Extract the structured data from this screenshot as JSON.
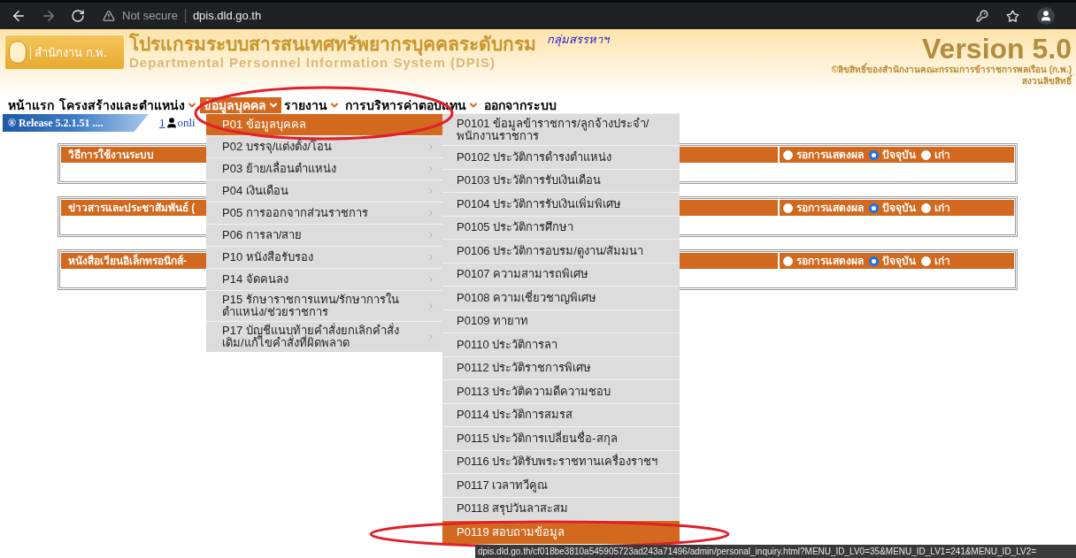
{
  "browser": {
    "security": "Not secure",
    "url": "dpis.dld.go.th"
  },
  "header": {
    "logo_text": "สำนักงาน ก.พ.",
    "title_th": "โปรแกรมระบบสารสนเทศทรัพยากรบุคคลระดับกรม",
    "title_en": "Departmental Personnel Information System (DPIS)",
    "group": "กลุ่มสรรหาฯ",
    "version": "Version 5.0",
    "copyright": "©ลิขสิทธิ์ของสำนักงานคณะกรรมการข้าราชการพลเรือน (ก.พ.)",
    "rights": "สงวนลิขสิทธิ์"
  },
  "menu_bar": [
    {
      "label": "หน้าแรก",
      "dropdown": false,
      "selected": false
    },
    {
      "label": "โครงสร้างและตำแหน่ง",
      "dropdown": true,
      "selected": false
    },
    {
      "label": "ข้อมูลบุคคล",
      "dropdown": true,
      "selected": true
    },
    {
      "label": "รายงาน",
      "dropdown": true,
      "selected": false
    },
    {
      "label": "การบริหารค่าตอบแทน",
      "dropdown": true,
      "selected": false
    },
    {
      "label": "ออกจากระบบ",
      "dropdown": false,
      "selected": false
    }
  ],
  "release": {
    "label": "® Release 5.2.1.51 ....",
    "online_count": "1",
    "online_label": "onli"
  },
  "panels": [
    {
      "title": "วิธีการใช้งานระบบ",
      "options": [
        {
          "label": "รอการแสดงผล",
          "selected": false
        },
        {
          "label": "ปัจจุบัน",
          "selected": true
        },
        {
          "label": "เก่า",
          "selected": false
        }
      ]
    },
    {
      "title": "ข่าวสารและประชาสัมพันธ์ (",
      "options": [
        {
          "label": "รอการแสดงผล",
          "selected": false
        },
        {
          "label": "ปัจจุบัน",
          "selected": true
        },
        {
          "label": "เก่า",
          "selected": false
        }
      ]
    },
    {
      "title": "หนังสือเวียนอิเล็กทรอนิกส์-",
      "options": [
        {
          "label": "รอการแสดงผล",
          "selected": false
        },
        {
          "label": "ปัจจุบัน",
          "selected": true
        },
        {
          "label": "เก่า",
          "selected": false
        }
      ]
    }
  ],
  "menu": [
    {
      "label": "P01 ข้อมูลบุคคล",
      "selected": true,
      "submenu": false
    },
    {
      "label": "P02 บรรจุ/แต่งตั้ง/โอน",
      "selected": false,
      "submenu": true
    },
    {
      "label": "P03 ย้าย/เลื่อนตำแหน่ง",
      "selected": false,
      "submenu": true
    },
    {
      "label": "P04 เงินเดือน",
      "selected": false,
      "submenu": true
    },
    {
      "label": "P05 การออกจากส่วนราชการ",
      "selected": false,
      "submenu": true
    },
    {
      "label": "P06 การลา/สาย",
      "selected": false,
      "submenu": true
    },
    {
      "label": "P10 หนังสือรับรอง",
      "selected": false,
      "submenu": true
    },
    {
      "label": "P14 จัดคนลง",
      "selected": false,
      "submenu": true
    },
    {
      "label": "P15 รักษาราชการแทน/รักษาการในตำแหน่ง/ช่วยราชการ",
      "selected": false,
      "submenu": true
    },
    {
      "label": "P17 บัญชีแนบท้ายคำสั่งยกเลิกคำสั่งเดิม/แก้ไขคำสั่งที่ผิดพลาด",
      "selected": false,
      "submenu": true
    }
  ],
  "submenu": [
    {
      "label": "P0101 ข้อมูลข้าราชการ/ลูกจ้างประจำ/พนักงานราชการ",
      "selected": false
    },
    {
      "label": "P0102 ประวัติการดำรงตำแหน่ง",
      "selected": false
    },
    {
      "label": "P0103 ประวัติการรับเงินเดือน",
      "selected": false
    },
    {
      "label": "P0104 ประวัติการรับเงินเพิ่มพิเศษ",
      "selected": false
    },
    {
      "label": "P0105 ประวัติการศึกษา",
      "selected": false
    },
    {
      "label": "P0106 ประวัติการอบรม/ดูงาน/สัมมนา",
      "selected": false
    },
    {
      "label": "P0107 ความสามารถพิเศษ",
      "selected": false
    },
    {
      "label": "P0108 ความเชี่ยวชาญพิเศษ",
      "selected": false
    },
    {
      "label": "P0109 ทายาท",
      "selected": false
    },
    {
      "label": "P0110 ประวัติการลา",
      "selected": false
    },
    {
      "label": "P0112 ประวัติราชการพิเศษ",
      "selected": false
    },
    {
      "label": "P0113 ประวัติความดีความชอบ",
      "selected": false
    },
    {
      "label": "P0114 ประวัติการสมรส",
      "selected": false
    },
    {
      "label": "P0115 ประวัติการเปลี่ยนชื่อ-สกุล",
      "selected": false
    },
    {
      "label": "P0116 ประวัติรับพระราชทานเครื่องราชฯ",
      "selected": false
    },
    {
      "label": "P0117 เวลาทวีคูณ",
      "selected": false
    },
    {
      "label": "P0118 สรุปวันลาสะสม",
      "selected": false
    },
    {
      "label": "P0119 สอบถามข้อมูล",
      "selected": true
    }
  ],
  "status_url": "dpis.dld.go.th/cf018be3810a545905723ad243a71496/admin/personal_inquiry.html?MENU_ID_LV0=35&MENU_ID_LV1=241&MENU_ID_LV2="
}
